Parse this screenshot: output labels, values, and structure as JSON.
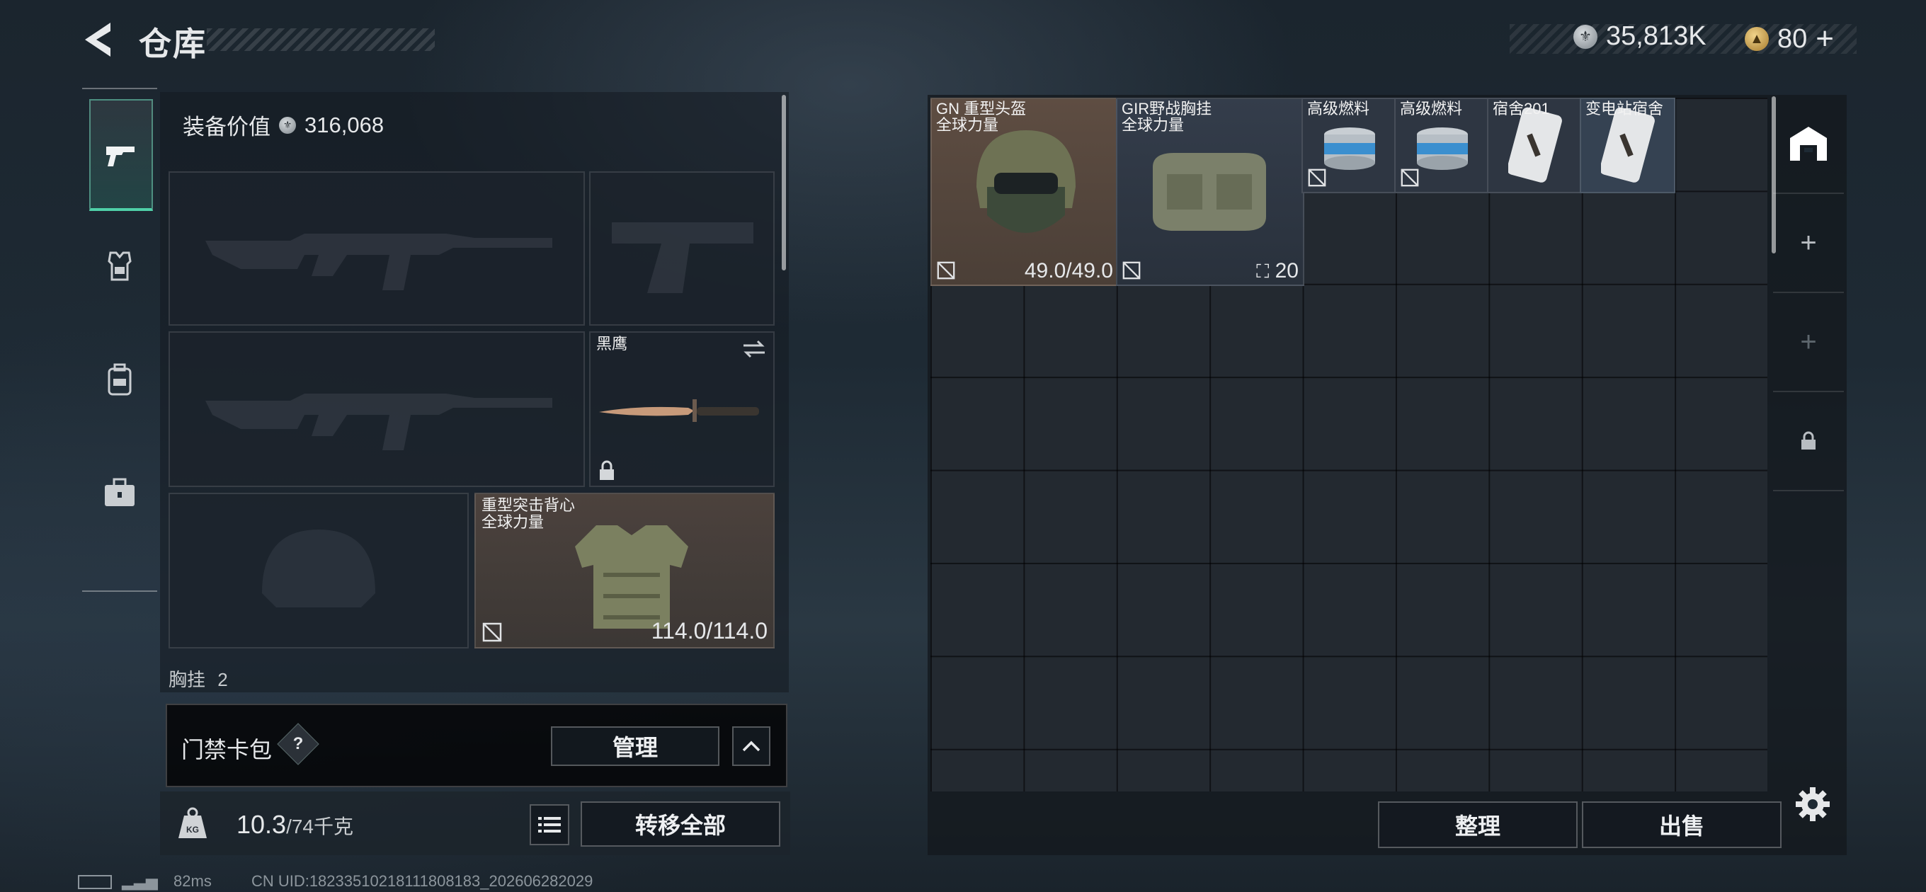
{
  "header": {
    "title": "仓库",
    "currency_silver": "35,813K",
    "currency_gold": "80",
    "currency_plus": "+"
  },
  "left_nav": [
    {
      "icon": "pistol-icon",
      "active": true
    },
    {
      "icon": "vest-icon"
    },
    {
      "icon": "backpack-icon"
    },
    {
      "icon": "toolbox-icon"
    }
  ],
  "equipment": {
    "value_label": "装备价值",
    "value": "316,068",
    "knife": {
      "label": "黑鹰"
    },
    "armor": {
      "label": "重型突击背心\n全球力量",
      "durability": "114.0/114.0"
    },
    "chest_label": "胸挂",
    "chest_count": "2"
  },
  "access_card": {
    "label": "门禁卡包",
    "help": "?",
    "manage": "管理"
  },
  "weight": {
    "current": "10.3",
    "max": "/74千克",
    "transfer_all": "转移全部"
  },
  "stash": {
    "items": [
      {
        "label": "GN 重型头盔\n全球力量",
        "value": "49.0/49.0"
      },
      {
        "label": "GIR野战胸挂\n全球力量",
        "value": "20"
      },
      {
        "label": "高级燃料"
      },
      {
        "label": "高级燃料"
      },
      {
        "label": "宿舍201"
      },
      {
        "label": "变电站宿舍"
      }
    ],
    "sort": "整理",
    "sell": "出售"
  },
  "colors": {
    "accent": "#4fd1a8",
    "filled_slot": "#5c4c42",
    "item_blue": "#2e3642"
  },
  "status": {
    "ping": "82ms",
    "uid": "CN UID:18233510218111808183_202606282029"
  }
}
